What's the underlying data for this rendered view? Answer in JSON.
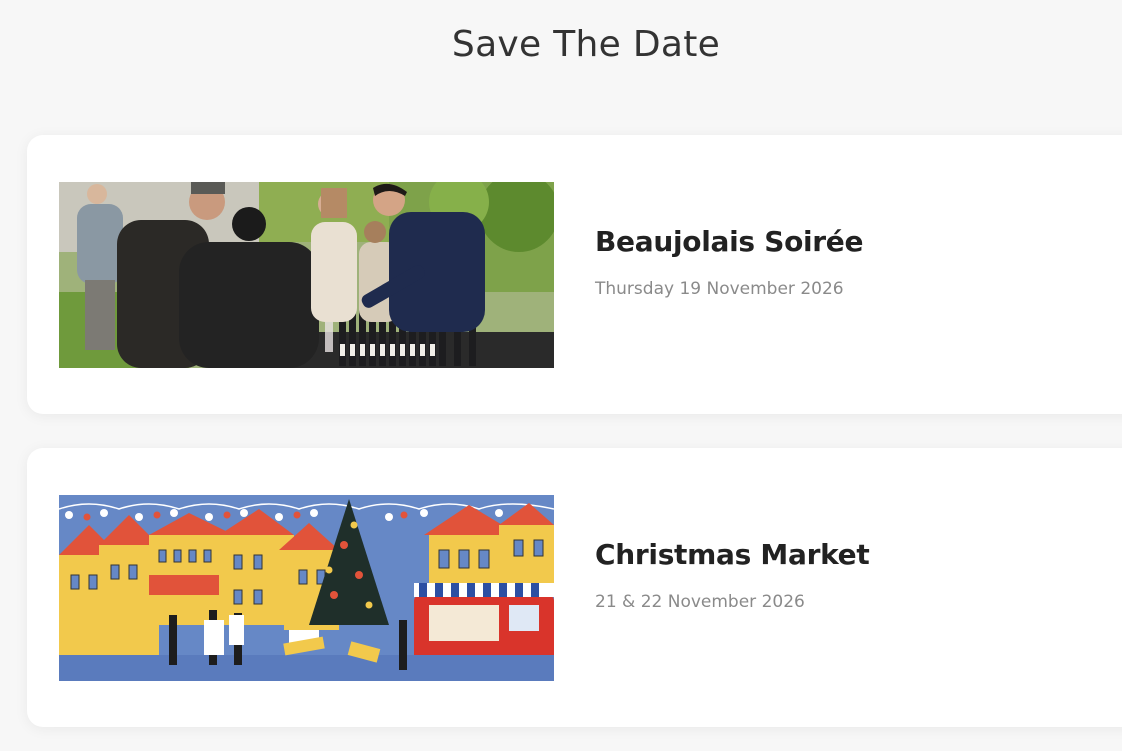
{
  "page": {
    "title": "Save The Date"
  },
  "events": [
    {
      "title": "Beaujolais Soirée",
      "date": "Thursday 19 November 2026",
      "image": "photo-people-wine-tasting"
    },
    {
      "title": "Christmas Market",
      "date": "21 & 22 November 2026",
      "image": "illustration-christmas-market"
    }
  ],
  "colors": {
    "background": "#f7f7f7",
    "card": "#ffffff",
    "title_text": "#222222",
    "date_text": "#8a8a8a",
    "market_blue": "#6688c6",
    "market_red": "#e1533a",
    "market_yellow": "#f2c94c"
  }
}
